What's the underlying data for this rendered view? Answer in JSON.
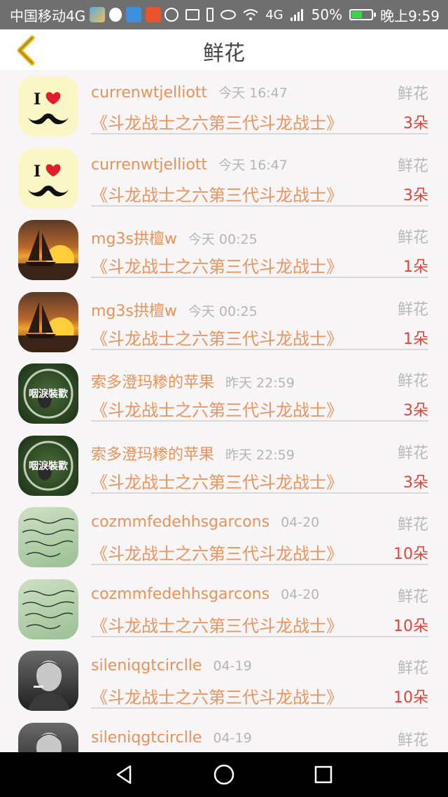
{
  "status_bar": {
    "carrier": "中国移动4G",
    "network": "4G",
    "battery_percent": "50%",
    "time": "晚上9:59"
  },
  "header": {
    "title": "鲜花",
    "back_icon": "chevron-left-icon",
    "accent": "#e8b923"
  },
  "colors": {
    "name": "#e8935a",
    "count": "#e0443a",
    "muted": "#b5b5b5"
  },
  "items": [
    {
      "name": "currenwtjelliott",
      "time": "今天 16:47",
      "gift": "鲜花",
      "book": "《斗龙战士之六第三代斗龙战士》",
      "count": "3朵",
      "avatar": "heart-mustache-avatar"
    },
    {
      "name": "currenwtjelliott",
      "time": "今天 16:47",
      "gift": "鲜花",
      "book": "《斗龙战士之六第三代斗龙战士》",
      "count": "3朵",
      "avatar": "heart-mustache-avatar"
    },
    {
      "name": "mg3s拱檀w",
      "time": "今天 00:25",
      "gift": "鲜花",
      "book": "《斗龙战士之六第三代斗龙战士》",
      "count": "1朵",
      "avatar": "sailboat-sunset-avatar"
    },
    {
      "name": "mg3s拱檀w",
      "time": "今天 00:25",
      "gift": "鲜花",
      "book": "《斗龙战士之六第三代斗龙战士》",
      "count": "1朵",
      "avatar": "sailboat-sunset-avatar"
    },
    {
      "name": "索多澄玛糁的苹果",
      "time": "昨天 22:59",
      "gift": "鲜花",
      "book": "《斗龙战士之六第三代斗龙战士》",
      "count": "3朵",
      "avatar": "green-photo-avatar",
      "avatar_text": "咽淚裝歡"
    },
    {
      "name": "索多澄玛糁的苹果",
      "time": "昨天 22:59",
      "gift": "鲜花",
      "book": "《斗龙战士之六第三代斗龙战士》",
      "count": "3朵",
      "avatar": "green-photo-avatar",
      "avatar_text": "咽淚裝歡"
    },
    {
      "name": "cozmmfedehhsgarcons",
      "time": "04-20",
      "gift": "鲜花",
      "book": "《斗龙战士之六第三代斗龙战士》",
      "count": "10朵",
      "avatar": "handwriting-avatar"
    },
    {
      "name": "cozmmfedehhsgarcons",
      "time": "04-20",
      "gift": "鲜花",
      "book": "《斗龙战士之六第三代斗龙战士》",
      "count": "10朵",
      "avatar": "handwriting-avatar"
    },
    {
      "name": "sileniqgtcirclle",
      "time": "04-19",
      "gift": "鲜花",
      "book": "《斗龙战士之六第三代斗龙战士》",
      "count": "10朵",
      "avatar": "man-smoking-avatar"
    },
    {
      "name": "sileniqgtcirclle",
      "time": "04-19",
      "gift": "鲜花",
      "book": "",
      "count": "",
      "avatar": "man-smoking-avatar"
    }
  ],
  "nav": {
    "back_icon": "triangle-back-icon",
    "home_icon": "circle-home-icon",
    "recents_icon": "square-recents-icon"
  }
}
